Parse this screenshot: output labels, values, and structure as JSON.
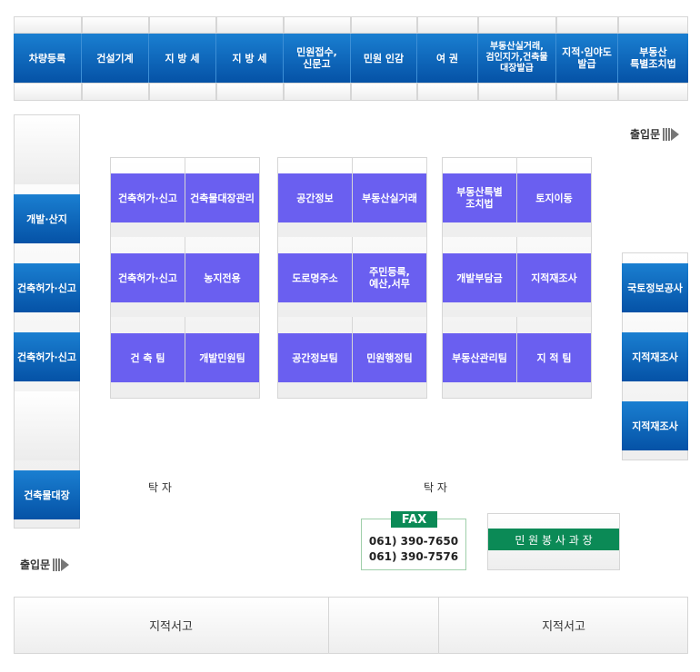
{
  "top_counters": [
    "차량등록",
    "건설기계",
    "지 방 세",
    "지 방 세",
    "민원접수,\n신문고",
    "민원 인감",
    "여  권",
    "부동산실거래,\n검인지가,건축물\n대장발급",
    "지적·임야도\n발급",
    "부동산\n특별조치법"
  ],
  "left_counters": [
    "개발·산지",
    "건축허가·신고",
    "건축허가·신고",
    "건축물대장"
  ],
  "right_counters": [
    "국토정보공사",
    "지적재조사",
    "지적재조사"
  ],
  "center_group_1": [
    [
      "건축허가·신고",
      "건축물대장관리"
    ],
    [
      "건축허가·신고",
      "농지전용"
    ],
    [
      "건 축 팀",
      "개발민원팀"
    ]
  ],
  "center_group_2": [
    [
      "공간정보",
      "부동산실거래"
    ],
    [
      "도로명주소",
      "주민등록,\n예산,서무"
    ],
    [
      "공간정보팀",
      "민원행정팀"
    ]
  ],
  "center_group_3": [
    [
      "부동산특별\n조치법",
      "토지이동"
    ],
    [
      "개발부담금",
      "지적재조사"
    ],
    [
      "부동산관리팀",
      "지 적 팀"
    ]
  ],
  "entrance_label": "출입문",
  "table_label": "탁 자",
  "fax": {
    "label": "FAX",
    "numbers": [
      "061) 390-7650",
      "061) 390-7576"
    ]
  },
  "office_label": "민 원 봉 사 과 장",
  "storage": [
    "지적서고",
    "지적서고"
  ],
  "colors": {
    "blue": "#0552a6",
    "purple": "#6a5ff0",
    "green": "#0b8a56"
  }
}
